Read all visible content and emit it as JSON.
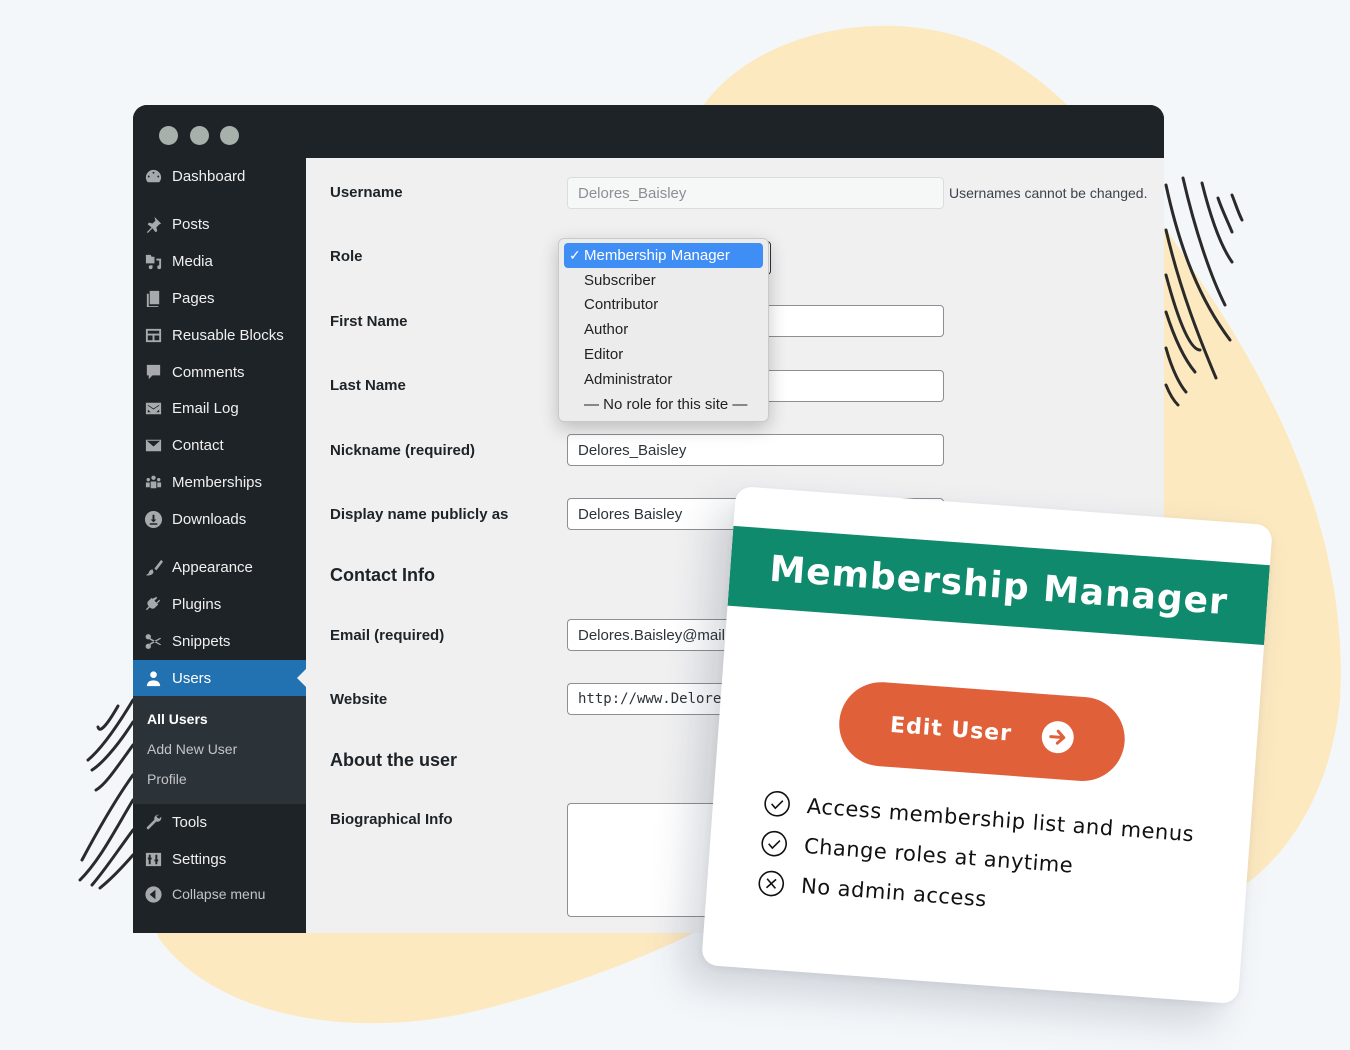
{
  "window": {
    "traffic_lights": [
      "close",
      "minimize",
      "maximize"
    ]
  },
  "sidebar": {
    "items": [
      {
        "label": "Dashboard",
        "icon": "dashboard-icon"
      },
      {
        "label": "Posts",
        "icon": "pin-icon"
      },
      {
        "label": "Media",
        "icon": "media-icon"
      },
      {
        "label": "Pages",
        "icon": "pages-icon"
      },
      {
        "label": "Reusable Blocks",
        "icon": "blocks-icon"
      },
      {
        "label": "Comments",
        "icon": "comment-icon"
      },
      {
        "label": "Email Log",
        "icon": "envelope-icon"
      },
      {
        "label": "Contact",
        "icon": "mail-icon"
      },
      {
        "label": "Memberships",
        "icon": "groups-icon"
      },
      {
        "label": "Downloads",
        "icon": "download-icon"
      },
      {
        "label": "Appearance",
        "icon": "brush-icon"
      },
      {
        "label": "Plugins",
        "icon": "plugin-icon"
      },
      {
        "label": "Snippets",
        "icon": "scissors-icon"
      },
      {
        "label": "Users",
        "icon": "user-icon",
        "active": true
      },
      {
        "label": "Tools",
        "icon": "wrench-icon"
      },
      {
        "label": "Settings",
        "icon": "settings-icon"
      },
      {
        "label": "Collapse menu",
        "icon": "collapse-icon"
      }
    ],
    "submenu": [
      {
        "label": "All Users",
        "current": true
      },
      {
        "label": "Add New User"
      },
      {
        "label": "Profile"
      }
    ]
  },
  "form": {
    "username": {
      "label": "Username",
      "value": "Delores_Baisley",
      "hint": "Usernames cannot be changed."
    },
    "role": {
      "label": "Role",
      "selected": "Membership Manager",
      "options": [
        "Membership Manager",
        "Subscriber",
        "Contributor",
        "Author",
        "Editor",
        "Administrator",
        "— No role for this site —"
      ]
    },
    "first_name": {
      "label": "First Name",
      "value": ""
    },
    "last_name": {
      "label": "Last Name",
      "value": ""
    },
    "nickname": {
      "label": "Nickname (required)",
      "value": "Delores_Baisley"
    },
    "display_name": {
      "label": "Display name publicly as",
      "value": "Delores Baisley"
    },
    "contact_section": "Contact Info",
    "email": {
      "label": "Email (required)",
      "value": "Delores.Baisley@mail.c"
    },
    "website": {
      "label": "Website",
      "value": "http://www.Delore"
    },
    "about_section": "About the user",
    "bio": {
      "label": "Biographical Info",
      "value": ""
    }
  },
  "promo_card": {
    "title": "Membership Manager",
    "button_label": "Edit User",
    "features": [
      {
        "text": "Access membership list and menus",
        "status": "allowed"
      },
      {
        "text": "Change roles at anytime",
        "status": "allowed"
      },
      {
        "text": "No admin access",
        "status": "denied"
      }
    ],
    "colors": {
      "banner": "#0f8a6c",
      "button": "#e0603a"
    }
  },
  "colors": {
    "accent": "#2271b1",
    "sidebar_bg": "#1d2327",
    "blob": "#fde9c0"
  }
}
